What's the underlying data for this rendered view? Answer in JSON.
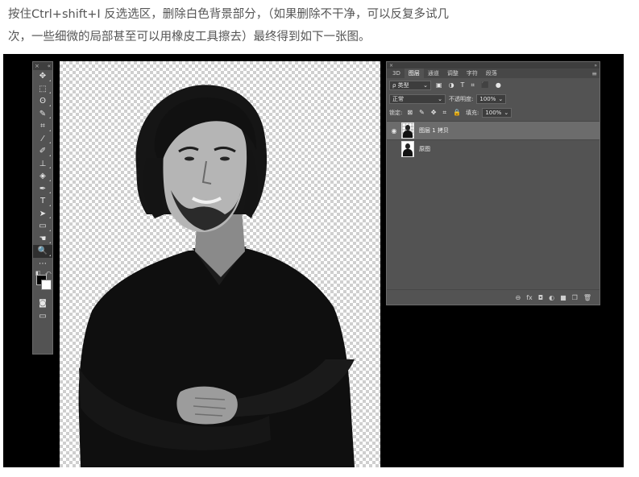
{
  "intro": {
    "line1": "按住Ctrl+shift+I 反选选区，删除白色背景部分，（如果删除不干净，可以反复多试几",
    "line2": "次，一些细微的局部甚至可以用橡皮工具擦去）最终得到如下一张图。"
  },
  "toolbar": {
    "collapse": "«",
    "close": "×",
    "tools": [
      {
        "name": "move-tool",
        "glyph": "✥"
      },
      {
        "name": "marquee-tool",
        "glyph": "⬚"
      },
      {
        "name": "lasso-tool",
        "glyph": "ʘ"
      },
      {
        "name": "quick-select-tool",
        "glyph": "✎"
      },
      {
        "name": "crop-tool",
        "glyph": "⌗"
      },
      {
        "name": "eyedropper-tool",
        "glyph": "⁄"
      },
      {
        "name": "brush-tool",
        "glyph": "✐"
      },
      {
        "name": "stamp-tool",
        "glyph": "⊥"
      },
      {
        "name": "eraser-tool",
        "glyph": "◈"
      },
      {
        "name": "pen-tool",
        "glyph": "✒"
      },
      {
        "name": "type-tool",
        "glyph": "T"
      },
      {
        "name": "path-select-tool",
        "glyph": "➤"
      },
      {
        "name": "rectangle-tool",
        "glyph": "▭"
      },
      {
        "name": "hand-tool",
        "glyph": "☚"
      },
      {
        "name": "zoom-tool",
        "glyph": "🔍"
      },
      {
        "name": "more-tools",
        "glyph": "⋯"
      }
    ],
    "mode_glyphs": [
      "◙",
      "▭"
    ]
  },
  "layers_panel": {
    "tabs": [
      "3D",
      "图层",
      "通道",
      "调整",
      "字符",
      "段落"
    ],
    "active_tab": "图层",
    "filter_label": "ρ 类型",
    "filter_icons": [
      "▣",
      "◑",
      "T",
      "⌗",
      "⬛",
      "●"
    ],
    "blend_mode": "正常",
    "opacity_label": "不透明度:",
    "opacity_value": "100%",
    "lock_label": "锁定:",
    "lock_icons": [
      "⊠",
      "✎",
      "✥",
      "⌗",
      "🔒"
    ],
    "fill_label": "填充:",
    "fill_value": "100%",
    "layers": [
      {
        "name": "图层 1 拷贝",
        "visible": true,
        "selected": true
      },
      {
        "name": "原图",
        "visible": false,
        "selected": false
      }
    ],
    "bottom_icons": [
      "⊖",
      "fx",
      "◘",
      "◐",
      "■",
      "❐",
      "🗑"
    ]
  },
  "colors": {
    "panel_bg": "#535353",
    "workspace_bg": "#000000",
    "selected_layer": "#6c6c6c",
    "foreground": "#000000",
    "background": "#ffffff"
  }
}
